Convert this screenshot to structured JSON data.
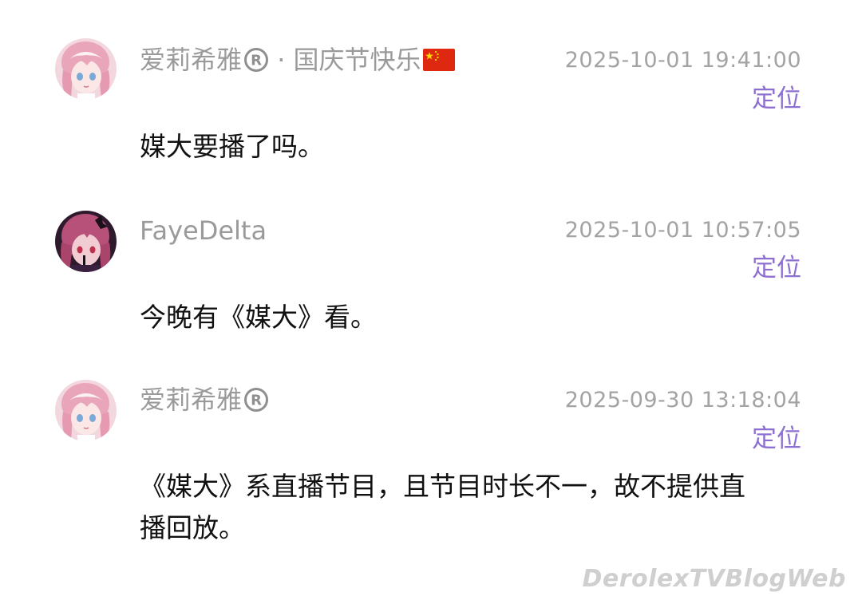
{
  "comments": [
    {
      "user": "爱莉希雅",
      "user_suffix": "· 国庆节快乐",
      "has_registered_mark": true,
      "has_flag": true,
      "avatar": "pink-hair-anime-avatar",
      "time": "2025-10-01 19:41:00",
      "locate_label": "定位",
      "text": "媒大要播了吗。"
    },
    {
      "user": "FayeDelta",
      "user_suffix": "",
      "has_registered_mark": false,
      "has_flag": false,
      "avatar": "dark-pink-anime-avatar",
      "time": "2025-10-01 10:57:05",
      "locate_label": "定位",
      "text": "今晚有《媒大》看。"
    },
    {
      "user": "爱莉希雅",
      "user_suffix": "",
      "has_registered_mark": true,
      "has_flag": false,
      "avatar": "pink-hair-anime-avatar",
      "time": "2025-09-30 13:18:04",
      "locate_label": "定位",
      "text": "《媒大》系直播节目，且节目时长不一，故不提供直播回放。"
    }
  ],
  "watermark": "DerolexTVBlogWeb",
  "colors": {
    "name": "#9a9a9a",
    "time": "#a3a3a3",
    "accent": "#8d6fd1",
    "text": "#111111",
    "watermark": "#cfcfcf"
  }
}
